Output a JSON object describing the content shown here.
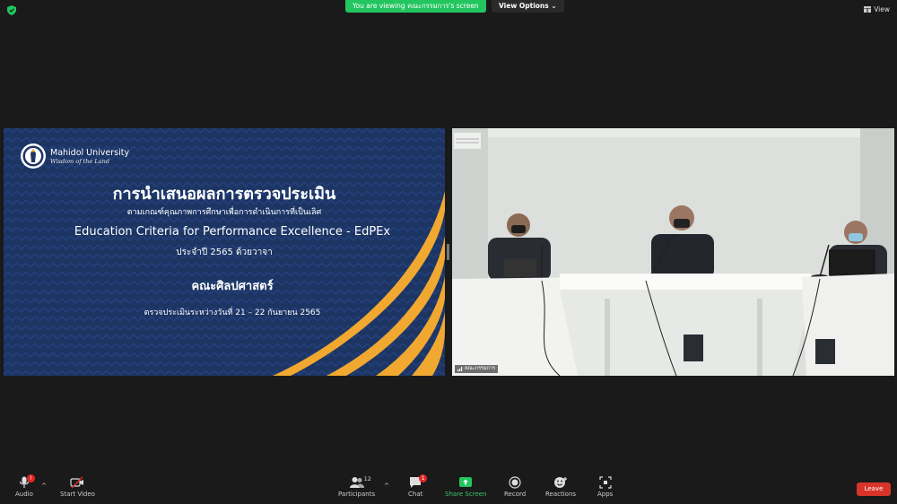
{
  "topbar": {
    "banner_text": "You are viewing คณะกรรมการ's screen",
    "view_options": "View Options",
    "view_label": "View"
  },
  "slide": {
    "university": "Mahidol University",
    "motto": "Wisdom of the Land",
    "title": "การนำเสนอผลการตรวจประเมิน",
    "subtitle": "ตามเกณฑ์คุณภาพการศึกษาเพื่อการดำเนินการที่เป็นเลิศ",
    "english_title": "Education Criteria for Performance Excellence - EdPEx",
    "year_line": "ประจำปี 2565 ด้วยวาจา",
    "faculty": "คณะศิลปศาสตร์",
    "date_line": "ตรวจประเมินระหว่างวันที่ 21 – 22 กันยายน 2565"
  },
  "video": {
    "participant_name": "คณะกรรมการ"
  },
  "toolbar": {
    "audio": "Audio",
    "audio_badge": "!",
    "start_video": "Start Video",
    "participants": "Participants",
    "participants_count": "12",
    "chat": "Chat",
    "chat_badge": "1",
    "share_screen": "Share Screen",
    "record": "Record",
    "reactions": "Reactions",
    "apps": "Apps",
    "leave": "Leave"
  },
  "colors": {
    "accent_green": "#23c55e",
    "leave_red": "#d9342b",
    "slide_navy": "#1c3563",
    "slide_gold": "#f0a830"
  }
}
